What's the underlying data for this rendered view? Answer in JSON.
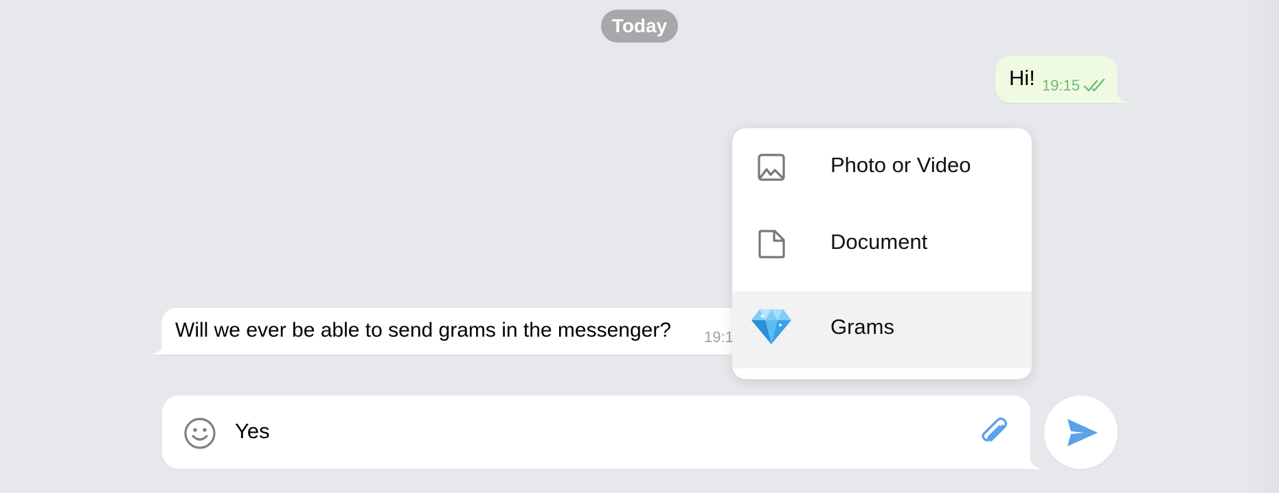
{
  "date_badge": "Today",
  "messages": [
    {
      "direction": "outgoing",
      "text": "Hi!",
      "time": "19:15",
      "status": "read"
    },
    {
      "direction": "incoming",
      "text": "Will we ever be able to send grams in the messenger?",
      "time": "19:1"
    }
  ],
  "attach_menu": {
    "items": [
      {
        "label": "Photo or Video",
        "icon": "photo-icon"
      },
      {
        "label": "Document",
        "icon": "document-icon"
      },
      {
        "label": "Grams",
        "icon": "diamond-icon",
        "highlighted": true
      }
    ]
  },
  "composer": {
    "value": "Yes",
    "emoji_icon": "smile-icon",
    "attach_icon": "paperclip-icon",
    "send_icon": "send-icon"
  },
  "colors": {
    "background": "#e6e8ec",
    "outgoing_bubble": "#eefbe2",
    "outgoing_time": "#6fba6b",
    "accent": "#5aa2ea",
    "badge": "#a7a8aa"
  }
}
